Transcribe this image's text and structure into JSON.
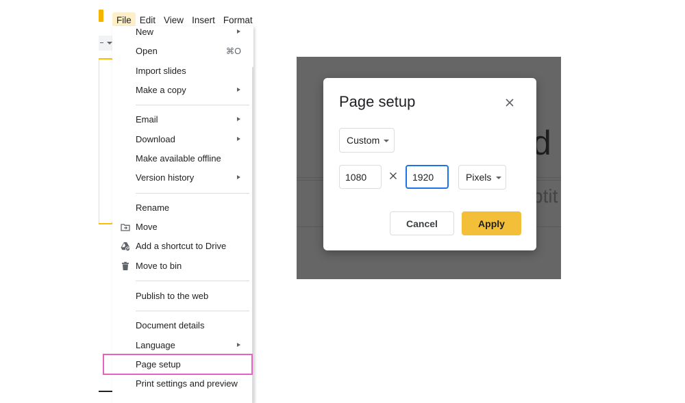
{
  "menubar": {
    "items": [
      {
        "label": "File"
      },
      {
        "label": "Edit"
      },
      {
        "label": "View"
      },
      {
        "label": "Insert"
      },
      {
        "label": "Format"
      }
    ]
  },
  "file_menu": {
    "items": [
      {
        "label": "New",
        "submenu": true
      },
      {
        "label": "Open",
        "shortcut": "⌘O"
      },
      {
        "label": "Import slides"
      },
      {
        "label": "Make a copy",
        "submenu": true
      },
      {
        "label": "Email",
        "submenu": true
      },
      {
        "label": "Download",
        "submenu": true
      },
      {
        "label": "Make available offline"
      },
      {
        "label": "Version history",
        "submenu": true
      },
      {
        "label": "Rename"
      },
      {
        "label": "Move",
        "icon": "move-folder-icon"
      },
      {
        "label": "Add a shortcut to Drive",
        "icon": "drive-shortcut-icon"
      },
      {
        "label": "Move to bin",
        "icon": "trash-icon"
      },
      {
        "label": "Publish to the web"
      },
      {
        "label": "Document details"
      },
      {
        "label": "Language",
        "submenu": true
      },
      {
        "label": "Page setup",
        "highlighted": true
      },
      {
        "label": "Print settings and preview"
      }
    ],
    "highlight_color": "#e562c3",
    "active_menu_bg": "#fdf0c8"
  },
  "dialog": {
    "title": "Page setup",
    "preset": "Custom",
    "width": "1080",
    "height": "1920",
    "units": "Pixels",
    "cancel_label": "Cancel",
    "apply_label": "Apply",
    "apply_color": "#f4bf38",
    "focus_color": "#1a73e8"
  },
  "background_slide": {
    "title_fragment": "d",
    "subtitle_fragment": "btit"
  }
}
